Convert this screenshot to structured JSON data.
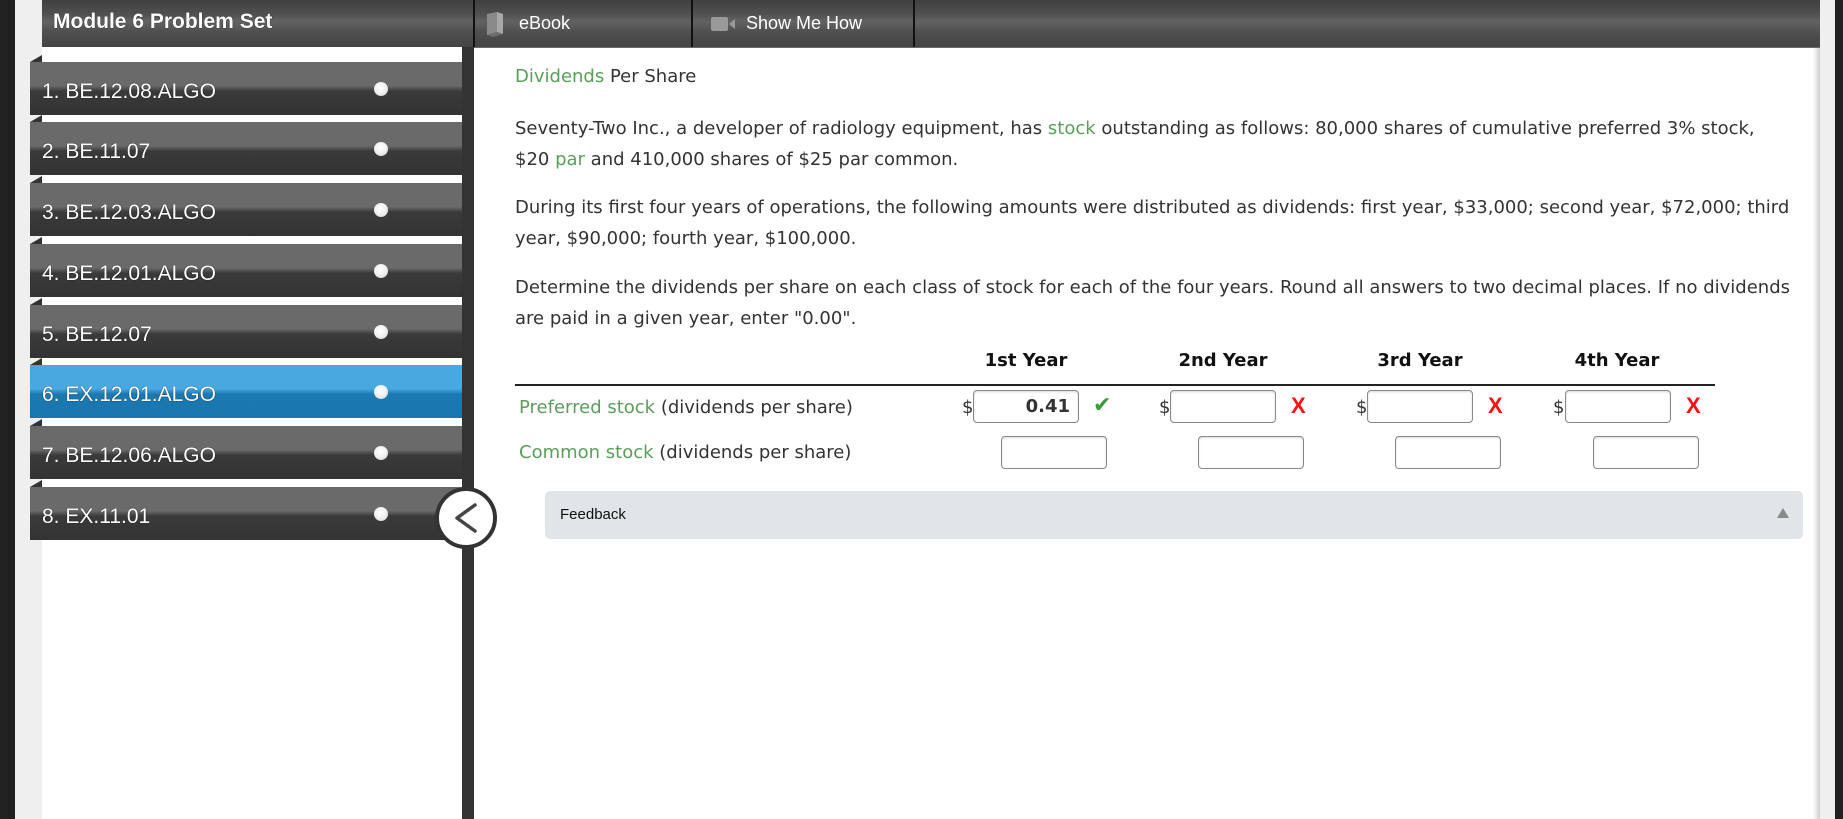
{
  "header": {
    "title": "Module 6 Problem Set",
    "tabs": [
      {
        "label": "eBook",
        "icon": "book-icon"
      },
      {
        "label": "Show Me How",
        "icon": "video-camera-icon"
      }
    ]
  },
  "sidebar": {
    "items": [
      {
        "label": "1. BE.12.08.ALGO",
        "active": false
      },
      {
        "label": "2. BE.11.07",
        "active": false
      },
      {
        "label": "3. BE.12.03.ALGO",
        "active": false
      },
      {
        "label": "4. BE.12.01.ALGO",
        "active": false
      },
      {
        "label": "5. BE.12.07",
        "active": false
      },
      {
        "label": "6. EX.12.01.ALGO",
        "active": true
      },
      {
        "label": "7. BE.12.06.ALGO",
        "active": false
      },
      {
        "label": "8. EX.11.01",
        "active": false
      }
    ],
    "collapse_icon": "chevron-left-icon"
  },
  "problem": {
    "title_link": "Dividends",
    "title_rest": " Per Share",
    "para1": {
      "a": "Seventy-Two Inc., a developer of radiology equipment, has ",
      "link1": "stock",
      "b": " outstanding as follows: 80,000 shares of cumulative preferred 3% stock,",
      "c": "$20 ",
      "link2": "par",
      "d": " and 410,000 shares of $25 par common."
    },
    "para2": {
      "line1": "During its first four years of operations, the following amounts were distributed as dividends: first year, $33,000; second year, $72,000; third",
      "line2": "year, $90,000; fourth year, $100,000."
    },
    "para3": {
      "line1": "Determine the dividends per share on each class of stock for each of the four years. Round all answers to two decimal places. If no dividends",
      "line2": "are paid in a given year, enter \"0.00\"."
    }
  },
  "table": {
    "columns": [
      "1st Year",
      "2nd Year",
      "3rd Year",
      "4th Year"
    ],
    "currency_symbol": "$",
    "rows": [
      {
        "label_link": "Preferred stock",
        "label_rest": " (dividends per share)",
        "values": [
          "0.41",
          "",
          "",
          ""
        ],
        "status": [
          "correct",
          "incorrect",
          "incorrect",
          "incorrect"
        ]
      },
      {
        "label_link": "Common stock",
        "label_rest": " (dividends per share)",
        "values": [
          "",
          "",
          "",
          ""
        ],
        "status": [
          "",
          "",
          "",
          ""
        ]
      }
    ],
    "marks": {
      "correct": "✔",
      "incorrect": "X"
    }
  },
  "feedback": {
    "label": "Feedback",
    "toggle_icon": "triangle-up-icon"
  },
  "colors": {
    "accent_green": "#5a9e5a",
    "active_blue": "#1c78b1",
    "correct": "#3a9a3a",
    "incorrect": "#ff1010"
  }
}
